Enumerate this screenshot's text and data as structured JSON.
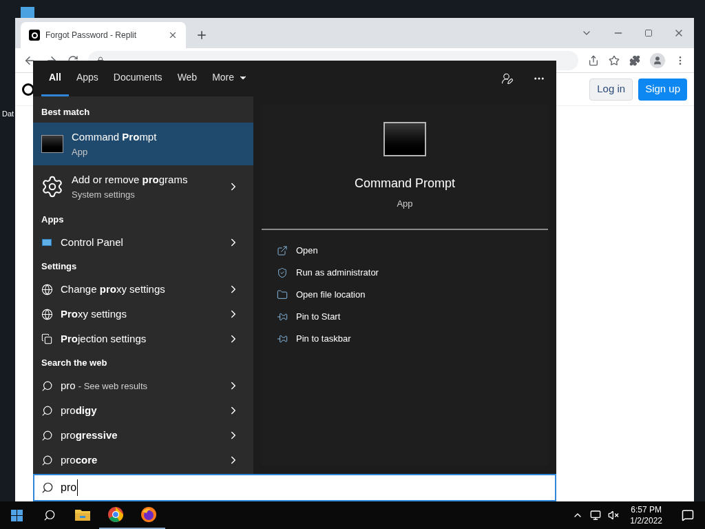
{
  "desktop_icons": [
    {
      "label": "Dat"
    }
  ],
  "browser": {
    "tab": {
      "title": "Forgot Password - Replit"
    },
    "page_buttons": [
      {
        "label": "Log in",
        "kind": "secondary"
      },
      {
        "label": "Sign up",
        "kind": "primary"
      }
    ]
  },
  "search": {
    "tabs": [
      {
        "label": "All",
        "selected": true,
        "kind": "tab"
      },
      {
        "label": "Apps",
        "selected": false,
        "kind": "tab"
      },
      {
        "label": "Documents",
        "selected": false,
        "kind": "tab"
      },
      {
        "label": "Web",
        "selected": false,
        "kind": "tab"
      },
      {
        "label": "More",
        "selected": false,
        "kind": "menu"
      }
    ],
    "groups": [
      {
        "heading": "Best match",
        "items": [
          {
            "kind": "terminal-app",
            "title": "Command **Pro**mpt",
            "subtitle": "App",
            "selected": true
          },
          {
            "kind": "settings-app",
            "title": "Add or remove **pro**grams",
            "subtitle": "System settings",
            "selected": false
          }
        ]
      },
      {
        "heading": "Apps",
        "items": [
          {
            "kind": "control-panel",
            "title": "Control Panel",
            "selected": false
          }
        ]
      },
      {
        "heading": "Settings",
        "items": [
          {
            "kind": "network-setting",
            "title": "Change **pro**xy settings",
            "selected": false
          },
          {
            "kind": "network-setting",
            "title": "**Pro**xy settings",
            "selected": false
          },
          {
            "kind": "display-setting",
            "title": "**Pro**jection settings",
            "selected": false
          }
        ]
      },
      {
        "heading": "Search the web",
        "items": [
          {
            "kind": "web-search",
            "title": "pro",
            "suffix": "- See web results",
            "selected": false
          },
          {
            "kind": "web-search",
            "title": "pro**digy**",
            "selected": false
          },
          {
            "kind": "web-search",
            "title": "pro**gressive**",
            "selected": false
          },
          {
            "kind": "web-search",
            "title": "pro**core**",
            "selected": false
          }
        ]
      }
    ],
    "preview": {
      "title": "Command Prompt",
      "subtitle": "App",
      "actions": [
        {
          "label": "Open",
          "kind": "open"
        },
        {
          "label": "Run as administrator",
          "kind": "admin"
        },
        {
          "label": "Open file location",
          "kind": "location"
        },
        {
          "label": "Pin to Start",
          "kind": "pin"
        },
        {
          "label": "Pin to taskbar",
          "kind": "pin"
        }
      ]
    },
    "query": "pro"
  },
  "taskbar": {
    "apps": [
      {
        "kind": "explorer",
        "running": false
      },
      {
        "kind": "chrome",
        "running": true
      },
      {
        "kind": "firefox",
        "running": true
      }
    ],
    "time": "6:57 PM",
    "date": "1/2/2022"
  }
}
